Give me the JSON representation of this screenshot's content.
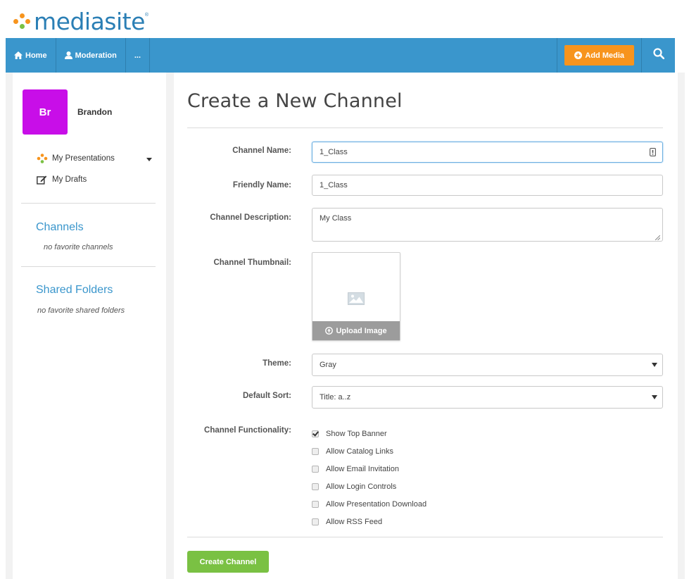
{
  "brand": {
    "name": "mediasite",
    "tm": "®"
  },
  "nav": {
    "home": "Home",
    "moderation": "Moderation",
    "more": "...",
    "add_media": "Add Media"
  },
  "user": {
    "initials": "Br",
    "name": "Brandon"
  },
  "sidebar": {
    "links": [
      {
        "label": "My Presentations",
        "icon": "presentations-icon"
      },
      {
        "label": "My Drafts",
        "icon": "edit-icon"
      }
    ],
    "channels": {
      "heading": "Channels",
      "empty": "no favorite channels"
    },
    "shared": {
      "heading": "Shared Folders",
      "empty": "no favorite shared folders"
    }
  },
  "form": {
    "title": "Create a New Channel",
    "channel_name_label": "Channel Name:",
    "channel_name_value": "1_Class",
    "friendly_name_label": "Friendly Name:",
    "friendly_name_value": "1_Class",
    "description_label": "Channel Description:",
    "description_value": "My Class",
    "thumbnail_label": "Channel Thumbnail:",
    "upload_label": "Upload Image",
    "theme_label": "Theme:",
    "theme_value": "Gray",
    "sort_label": "Default Sort:",
    "sort_value": "Title: a..z",
    "functionality_label": "Channel Functionality:",
    "options": [
      {
        "label": "Show Top Banner",
        "checked": true
      },
      {
        "label": "Allow Catalog Links",
        "checked": false
      },
      {
        "label": "Allow Email Invitation",
        "checked": false
      },
      {
        "label": "Allow Login Controls",
        "checked": false
      },
      {
        "label": "Allow Presentation Download",
        "checked": false
      },
      {
        "label": "Allow RSS Feed",
        "checked": false
      }
    ],
    "submit_label": "Create Channel"
  },
  "colors": {
    "nav": "#3a96cc",
    "accent_orange": "#f7941d",
    "avatar": "#c80ee8",
    "submit": "#7ac143",
    "link": "#3a96cc"
  }
}
